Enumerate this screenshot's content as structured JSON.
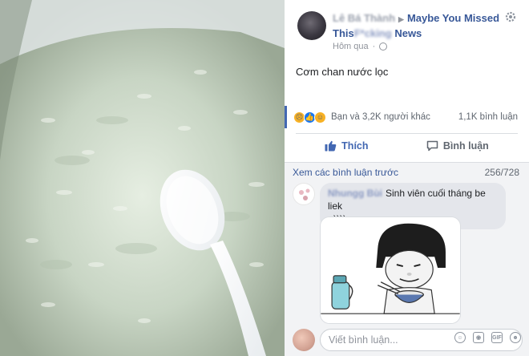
{
  "post": {
    "author": "Lê Bá Thành",
    "group_line1": "Maybe You Missed",
    "group_line2_prefix": "This",
    "group_line2_blurred": "F*cking",
    "group_line2_suffix": "News",
    "time": "Hôm qua",
    "text": "Cơm chan nước lọc"
  },
  "reactions": {
    "summary": "Bạn và 3,2K người khác",
    "comment_count": "1,1K bình luận",
    "icons": [
      "sad-icon",
      "like-icon",
      "haha-icon"
    ]
  },
  "actions": {
    "like": "Thích",
    "comment": "Bình luận"
  },
  "comments": {
    "view_previous": "Xem các bình luận trước",
    "pager": "256/728",
    "items": [
      {
        "author": "Nhungg Bùi",
        "text": "Sinh viên cuối tháng be liek",
        "text_line2": "=))))"
      }
    ]
  },
  "composer": {
    "placeholder": "Viết bình luận..."
  },
  "colors": {
    "accent": "#385898",
    "like_blue": "#4267b2",
    "comment_bg": "#f2f3f5"
  }
}
